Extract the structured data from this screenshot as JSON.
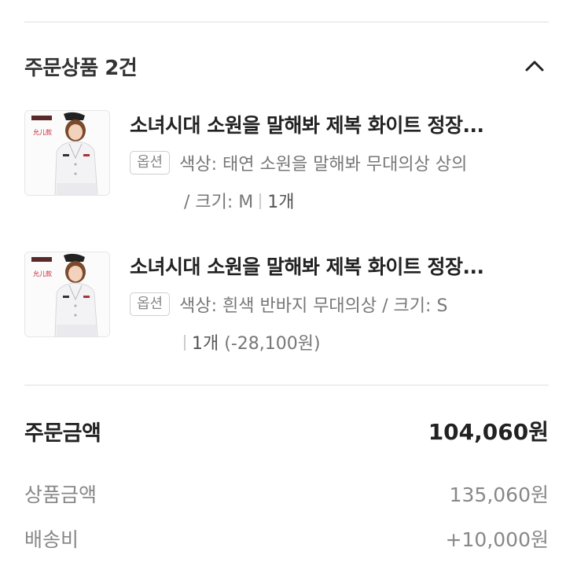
{
  "order_items": {
    "title": "주문상품 2건",
    "collapse_icon": "chevron-up-icon",
    "items": [
      {
        "name": "소녀시대 소원을 말해봐 제복 화이트 정장...",
        "option_badge": "옵션",
        "option_line1": "색상: 태연 소원을 말해봐 무대의상 상의",
        "option_line2": "/ 크기: M",
        "quantity": "1개",
        "price_note": ""
      },
      {
        "name": "소녀시대 소원을 말해봐 제복 화이트 정장...",
        "option_badge": "옵션",
        "option_line1": "색상: 흰색 반바지 무대의상 / 크기: S",
        "option_line2": "",
        "quantity": "1개",
        "price_note": "(-28,100원)"
      }
    ]
  },
  "summary": {
    "total_label": "주문금액",
    "total_value": "104,060원",
    "product_label": "상품금액",
    "product_value": "135,060원",
    "shipping_label": "배송비",
    "shipping_value": "+10,000원"
  },
  "thumb_caption": "允儿款",
  "colors": {
    "divider": "#eeeeee",
    "text_primary": "#222222",
    "text_secondary": "#888888"
  }
}
